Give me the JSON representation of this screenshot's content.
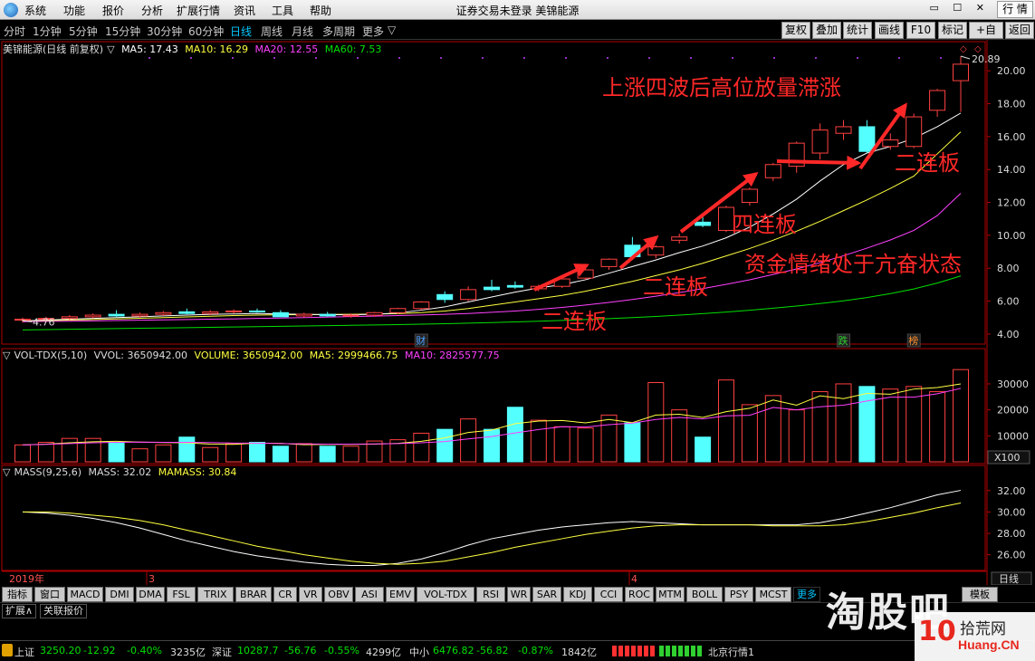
{
  "menubar": {
    "items": [
      "系统",
      "功能",
      "报价",
      "分析",
      "扩展行情",
      "资讯",
      "工具",
      "帮助"
    ],
    "title": "证券交易未登录 美锦能源",
    "hq_button": "行 情"
  },
  "periods": {
    "items": [
      "分时",
      "1分钟",
      "5分钟",
      "15分钟",
      "30分钟",
      "60分钟",
      "日线",
      "周线",
      "月线",
      "多周期",
      "更多"
    ],
    "active": "日线"
  },
  "toolbar": {
    "items": [
      "复权",
      "叠加",
      "统计",
      "画线",
      "F10",
      "标记",
      "+自选",
      "返回"
    ]
  },
  "colors": {
    "up": "#ff4040",
    "down": "#54ffff",
    "ma5": "#ffffff",
    "ma10": "#ffff40",
    "ma20": "#ff40ff",
    "ma60": "#00e000",
    "axis": "#b00000",
    "arrow": "#ff2828",
    "annotation": "#ff2828"
  },
  "price_header": {
    "stock": "美锦能源(日线 前复权)",
    "ma5": "MA5: 17.43",
    "ma10": "MA10: 16.29",
    "ma20": "MA20: 12.55",
    "ma60": "MA60: 7.53"
  },
  "vol_header": {
    "name": "VOL-TDX(5,10)",
    "vvol": "VVOL: 3650942.00",
    "volume": "VOLUME: 3650942.00",
    "ma5": "MA5: 2999466.75",
    "ma10": "MA10: 2825577.75"
  },
  "mass_header": {
    "name": "MASS(9,25,6)",
    "mass": "MASS: 32.02",
    "mamass": "MAMASS: 30.84"
  },
  "date_axis": {
    "year": "2019年",
    "months": [
      "3",
      "4"
    ],
    "period": "日线"
  },
  "chart_data": [
    {
      "type": "candlestick",
      "title": "美锦能源(日线 前复权)",
      "y_ticks": [
        "4.00",
        "6.00",
        "8.00",
        "10.00",
        "12.00",
        "14.00",
        "16.00",
        "18.00",
        "20.00"
      ],
      "ylim": [
        3.5,
        21.0
      ],
      "max_label": "20.89",
      "min_label": "4.76",
      "markers": [
        "财",
        "跌",
        "榜"
      ],
      "candles": [
        {
          "o": 4.85,
          "h": 5.0,
          "l": 4.7,
          "c": 4.9
        },
        {
          "o": 4.9,
          "h": 5.05,
          "l": 4.8,
          "c": 4.95
        },
        {
          "o": 4.95,
          "h": 5.15,
          "l": 4.85,
          "c": 5.05
        },
        {
          "o": 5.05,
          "h": 5.25,
          "l": 4.95,
          "c": 5.15
        },
        {
          "o": 5.2,
          "h": 5.45,
          "l": 5.05,
          "c": 5.1
        },
        {
          "o": 5.1,
          "h": 5.3,
          "l": 5.0,
          "c": 5.2
        },
        {
          "o": 5.2,
          "h": 5.4,
          "l": 5.1,
          "c": 5.3
        },
        {
          "o": 5.35,
          "h": 5.55,
          "l": 5.2,
          "c": 5.25
        },
        {
          "o": 5.25,
          "h": 5.45,
          "l": 5.15,
          "c": 5.35
        },
        {
          "o": 5.35,
          "h": 5.5,
          "l": 5.25,
          "c": 5.4
        },
        {
          "o": 5.4,
          "h": 5.55,
          "l": 5.3,
          "c": 5.35
        },
        {
          "o": 5.3,
          "h": 5.45,
          "l": 5.15,
          "c": 5.05
        },
        {
          "o": 5.1,
          "h": 5.3,
          "l": 5.0,
          "c": 5.2
        },
        {
          "o": 5.2,
          "h": 5.35,
          "l": 5.05,
          "c": 5.1
        },
        {
          "o": 5.1,
          "h": 5.25,
          "l": 5.0,
          "c": 5.15
        },
        {
          "o": 5.15,
          "h": 5.35,
          "l": 5.05,
          "c": 5.3
        },
        {
          "o": 5.3,
          "h": 5.6,
          "l": 5.2,
          "c": 5.55
        },
        {
          "o": 5.55,
          "h": 6.0,
          "l": 5.45,
          "c": 5.95
        },
        {
          "o": 6.4,
          "h": 6.6,
          "l": 5.9,
          "c": 6.1
        },
        {
          "o": 6.1,
          "h": 6.9,
          "l": 6.0,
          "c": 6.7
        },
        {
          "o": 6.85,
          "h": 7.3,
          "l": 6.6,
          "c": 6.7
        },
        {
          "o": 6.95,
          "h": 7.2,
          "l": 6.75,
          "c": 6.85
        },
        {
          "o": 6.75,
          "h": 7.0,
          "l": 6.6,
          "c": 6.9
        },
        {
          "o": 6.9,
          "h": 7.4,
          "l": 6.8,
          "c": 7.35
        },
        {
          "o": 7.4,
          "h": 8.0,
          "l": 7.3,
          "c": 7.9
        },
        {
          "o": 8.1,
          "h": 8.6,
          "l": 7.9,
          "c": 8.55
        },
        {
          "o": 9.4,
          "h": 9.9,
          "l": 8.5,
          "c": 8.7
        },
        {
          "o": 8.8,
          "h": 9.4,
          "l": 8.6,
          "c": 9.3
        },
        {
          "o": 9.7,
          "h": 10.1,
          "l": 9.5,
          "c": 9.9
        },
        {
          "o": 10.8,
          "h": 11.2,
          "l": 10.5,
          "c": 10.6
        },
        {
          "o": 10.3,
          "h": 11.8,
          "l": 10.2,
          "c": 11.7
        },
        {
          "o": 12.0,
          "h": 12.9,
          "l": 11.8,
          "c": 12.8
        },
        {
          "o": 13.5,
          "h": 14.4,
          "l": 13.3,
          "c": 14.3
        },
        {
          "o": 14.2,
          "h": 15.7,
          "l": 13.8,
          "c": 15.6
        },
        {
          "o": 15.0,
          "h": 16.8,
          "l": 14.6,
          "c": 16.4
        },
        {
          "o": 16.2,
          "h": 17.0,
          "l": 15.8,
          "c": 16.6
        },
        {
          "o": 16.6,
          "h": 17.0,
          "l": 15.0,
          "c": 15.1
        },
        {
          "o": 15.4,
          "h": 16.2,
          "l": 15.2,
          "c": 15.8
        },
        {
          "o": 15.4,
          "h": 17.4,
          "l": 15.3,
          "c": 17.2
        },
        {
          "o": 17.6,
          "h": 18.9,
          "l": 17.2,
          "c": 18.8
        },
        {
          "o": 19.4,
          "h": 20.89,
          "l": 17.5,
          "c": 20.4
        }
      ],
      "ma5": [
        4.8,
        4.85,
        4.9,
        4.95,
        5.0,
        5.05,
        5.1,
        5.15,
        5.2,
        5.22,
        5.25,
        5.22,
        5.2,
        5.18,
        5.17,
        5.2,
        5.28,
        5.45,
        5.65,
        5.95,
        6.25,
        6.55,
        6.8,
        7.0,
        7.3,
        7.7,
        8.1,
        8.5,
        8.95,
        9.35,
        9.85,
        10.5,
        11.3,
        12.2,
        13.3,
        14.3,
        15.0,
        15.4,
        15.9,
        16.6,
        17.43
      ],
      "ma10": [
        4.8,
        4.82,
        4.85,
        4.88,
        4.92,
        4.96,
        5.0,
        5.04,
        5.08,
        5.12,
        5.15,
        5.17,
        5.18,
        5.19,
        5.2,
        5.21,
        5.24,
        5.3,
        5.4,
        5.55,
        5.75,
        5.95,
        6.15,
        6.35,
        6.6,
        6.9,
        7.2,
        7.55,
        7.9,
        8.3,
        8.75,
        9.2,
        9.7,
        10.25,
        10.85,
        11.5,
        12.15,
        12.85,
        13.6,
        14.95,
        16.29
      ],
      "ma20": [
        4.75,
        4.77,
        4.78,
        4.8,
        4.82,
        4.84,
        4.86,
        4.88,
        4.9,
        4.92,
        4.95,
        4.97,
        5.0,
        5.03,
        5.06,
        5.09,
        5.12,
        5.16,
        5.2,
        5.25,
        5.32,
        5.4,
        5.5,
        5.62,
        5.76,
        5.92,
        6.1,
        6.3,
        6.52,
        6.76,
        7.02,
        7.3,
        7.62,
        7.96,
        8.34,
        8.76,
        9.22,
        9.72,
        10.3,
        11.2,
        12.55
      ],
      "ma60": [
        4.25,
        4.27,
        4.29,
        4.31,
        4.33,
        4.35,
        4.37,
        4.39,
        4.41,
        4.43,
        4.45,
        4.47,
        4.49,
        4.51,
        4.53,
        4.55,
        4.57,
        4.6,
        4.63,
        4.66,
        4.7,
        4.74,
        4.78,
        4.83,
        4.88,
        4.94,
        5.0,
        5.07,
        5.15,
        5.24,
        5.34,
        5.45,
        5.57,
        5.7,
        5.85,
        6.02,
        6.22,
        6.46,
        6.74,
        7.1,
        7.53
      ]
    },
    {
      "type": "bar",
      "title": "VOL-TDX(5,10)",
      "y_ticks": [
        "10000",
        "20000",
        "30000"
      ],
      "unit_label": "X100",
      "ylim": [
        0,
        38000
      ],
      "volumes": [
        6500,
        7500,
        9000,
        9000,
        7500,
        5000,
        6500,
        9500,
        5500,
        7000,
        7500,
        6000,
        7000,
        6000,
        6000,
        8000,
        8500,
        11000,
        12500,
        16500,
        12500,
        21000,
        16000,
        13500,
        13000,
        18000,
        15000,
        30500,
        20000,
        9500,
        31500,
        22000,
        25500,
        20000,
        27000,
        30000,
        29000,
        28000,
        29000,
        27000,
        35500
      ],
      "ma5": [
        6500,
        6800,
        7300,
        7700,
        7900,
        7600,
        7400,
        7300,
        6800,
        6700,
        7200,
        7100,
        6600,
        6700,
        6700,
        6800,
        7100,
        7900,
        9200,
        11300,
        12200,
        14700,
        15700,
        15900,
        15000,
        16300,
        15100,
        18000,
        18300,
        17100,
        19300,
        20600,
        23800,
        21800,
        25400,
        24300,
        26300,
        26000,
        28000,
        28600,
        29995
      ],
      "ma10": [
        6500,
        6700,
        7000,
        7300,
        7500,
        7600,
        7500,
        7500,
        7400,
        7200,
        7200,
        7000,
        6900,
        6800,
        6800,
        6900,
        7000,
        7300,
        7800,
        8800,
        9700,
        11100,
        12400,
        13500,
        13400,
        14300,
        14900,
        16300,
        17100,
        16500,
        17700,
        17900,
        20900,
        20000,
        21200,
        21800,
        23400,
        24900,
        24900,
        26200,
        28256
      ]
    },
    {
      "type": "line",
      "title": "MASS(9,25,6)",
      "y_ticks": [
        "26.00",
        "28.00",
        "30.00",
        "32.00"
      ],
      "ylim": [
        24.7,
        33.0
      ],
      "mass": [
        30.0,
        29.9,
        29.7,
        29.4,
        29.0,
        28.5,
        27.9,
        27.3,
        26.8,
        26.3,
        25.9,
        25.6,
        25.3,
        25.1,
        25.0,
        25.0,
        25.2,
        25.6,
        26.2,
        26.9,
        27.5,
        27.9,
        28.3,
        28.6,
        28.8,
        29.0,
        29.1,
        29.0,
        28.9,
        28.8,
        28.8,
        28.8,
        28.8,
        28.8,
        29.0,
        29.4,
        29.9,
        30.4,
        31.0,
        31.6,
        32.02
      ],
      "mamass": [
        30.0,
        30.0,
        29.9,
        29.7,
        29.5,
        29.2,
        28.8,
        28.3,
        27.8,
        27.3,
        26.8,
        26.4,
        26.0,
        25.7,
        25.4,
        25.2,
        25.1,
        25.2,
        25.4,
        25.8,
        26.2,
        26.7,
        27.1,
        27.5,
        27.9,
        28.2,
        28.5,
        28.7,
        28.8,
        28.8,
        28.8,
        28.8,
        28.7,
        28.7,
        28.7,
        28.8,
        29.1,
        29.5,
        29.9,
        30.4,
        30.84
      ]
    }
  ],
  "annotations": {
    "title": "上涨四波后高位放量滞涨",
    "four_board": "四连板",
    "emotion": "资金情绪处于亢奋状态",
    "two_board_a": "二连板",
    "two_board_b": "二连板",
    "two_board_c": "二连板"
  },
  "indicator_tabs": {
    "items": [
      "指标",
      "窗口",
      "MACD",
      "DMI",
      "DMA",
      "FSL",
      "TRIX",
      "BRAR",
      "CR",
      "VR",
      "OBV",
      "ASI",
      "EMV",
      "VOL-TDX",
      "RSI",
      "WR",
      "SAR",
      "KDJ",
      "CCI",
      "ROC",
      "MTM",
      "BOLL",
      "PSY",
      "MCST"
    ],
    "more": "更多",
    "template": "模板"
  },
  "ext_tabs": [
    "扩展∧",
    "关联报价"
  ],
  "status": {
    "sh_label": "上证",
    "sh_value": "3250.20",
    "sh_change": "-12.92",
    "sh_pct": "-0.40%",
    "sh_amount": "3235亿",
    "sz_label": "深证",
    "sz_value": "10287.7",
    "sz_change": "-56.76",
    "sz_pct": "-0.55%",
    "sz_amount": "4299亿",
    "zx_label": "中小",
    "zx_value": "6476.82",
    "zx_change": "-56.82",
    "zx_pct": "-0.87%",
    "zx_amount": "1842亿",
    "server": "北京行情1"
  },
  "watermark": {
    "big": "淘股吧",
    "brand_cn": "拾荒网",
    "brand_num": "10",
    "brand_url": "Huang.CN"
  }
}
